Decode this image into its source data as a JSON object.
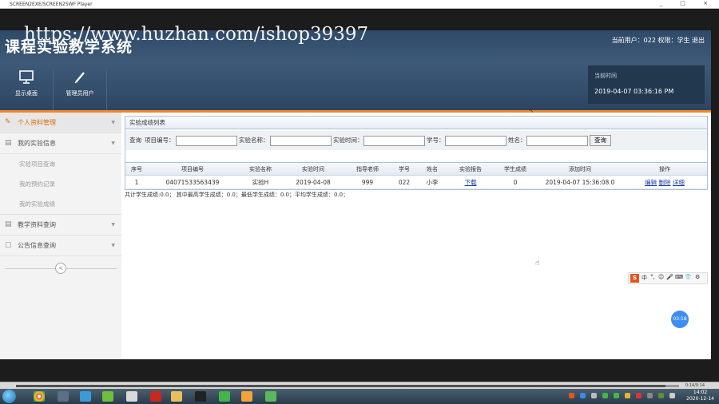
{
  "player": {
    "title": "SCREEN2EXE/SCREEN2SWF Player",
    "controls": "_ □ ×",
    "progress": 0.98,
    "time": "0:14/0:14"
  },
  "watermark": "https://www.huzhan.com/ishop39397",
  "app": {
    "title": "课程实验教学系统",
    "user_line": "当前用户：022  权限：学生  退出",
    "tools": [
      {
        "label": "显示桌面",
        "icon": "monitor-icon"
      },
      {
        "label": "管理员用户",
        "icon": "pencil-icon"
      }
    ],
    "time_box": {
      "label": "当前时间",
      "value": "2019-04-07 03:36:16 PM"
    }
  },
  "sidebar": {
    "items": [
      {
        "label": "个人资料管理",
        "icon": "pencil-icon",
        "active": true
      },
      {
        "label": "我的实验信息",
        "icon": "grid-icon",
        "active": false
      },
      {
        "label": "教学资料查询",
        "icon": "grid-icon",
        "active": false
      },
      {
        "label": "公告信息查询",
        "icon": "document-icon",
        "active": false
      }
    ],
    "subitems": [
      "实验项目查询",
      "我的预约记录",
      "我的实验成绩"
    ],
    "collapse_glyph": "<"
  },
  "panel": {
    "title": "实验成绩列表",
    "search": {
      "query_label": "查询",
      "labels": [
        "项目编号：",
        "实验名称：",
        "实验时间：",
        "学号：",
        "姓名："
      ],
      "button": "查询"
    }
  },
  "table": {
    "columns": [
      "序号",
      "项目编号",
      "实验名称",
      "实验时间",
      "指导老师",
      "学号",
      "姓名",
      "实验报告",
      "学生成绩",
      "添加时间",
      "操作"
    ],
    "rows": [
      {
        "cells": [
          "1",
          "04071533563439",
          "实验H",
          "2019-04-08",
          "999",
          "022",
          "小李",
          "下载",
          "0",
          "2019-04-07 15:36:08.0"
        ],
        "actions": [
          "编辑",
          "删除",
          "详细"
        ]
      }
    ]
  },
  "summary": "共计学生成绩:0.0；  其中最高学生成绩：0.0；最低学生成绩：0.0；平均学生成绩：0.0；",
  "overlay": {
    "badge": "03:18",
    "ime_logo": "S",
    "ime_glyphs": [
      "中",
      "°,",
      "☺",
      "🎤",
      "⌨",
      "👕",
      "⚙"
    ]
  },
  "taskbar": {
    "clock_time": "14:02",
    "clock_date": "2020-12-14"
  },
  "colors": {
    "header": "#2f4a68",
    "accent": "#f08a2a",
    "link": "#1a3ea8",
    "active_menu": "#e06a10"
  }
}
